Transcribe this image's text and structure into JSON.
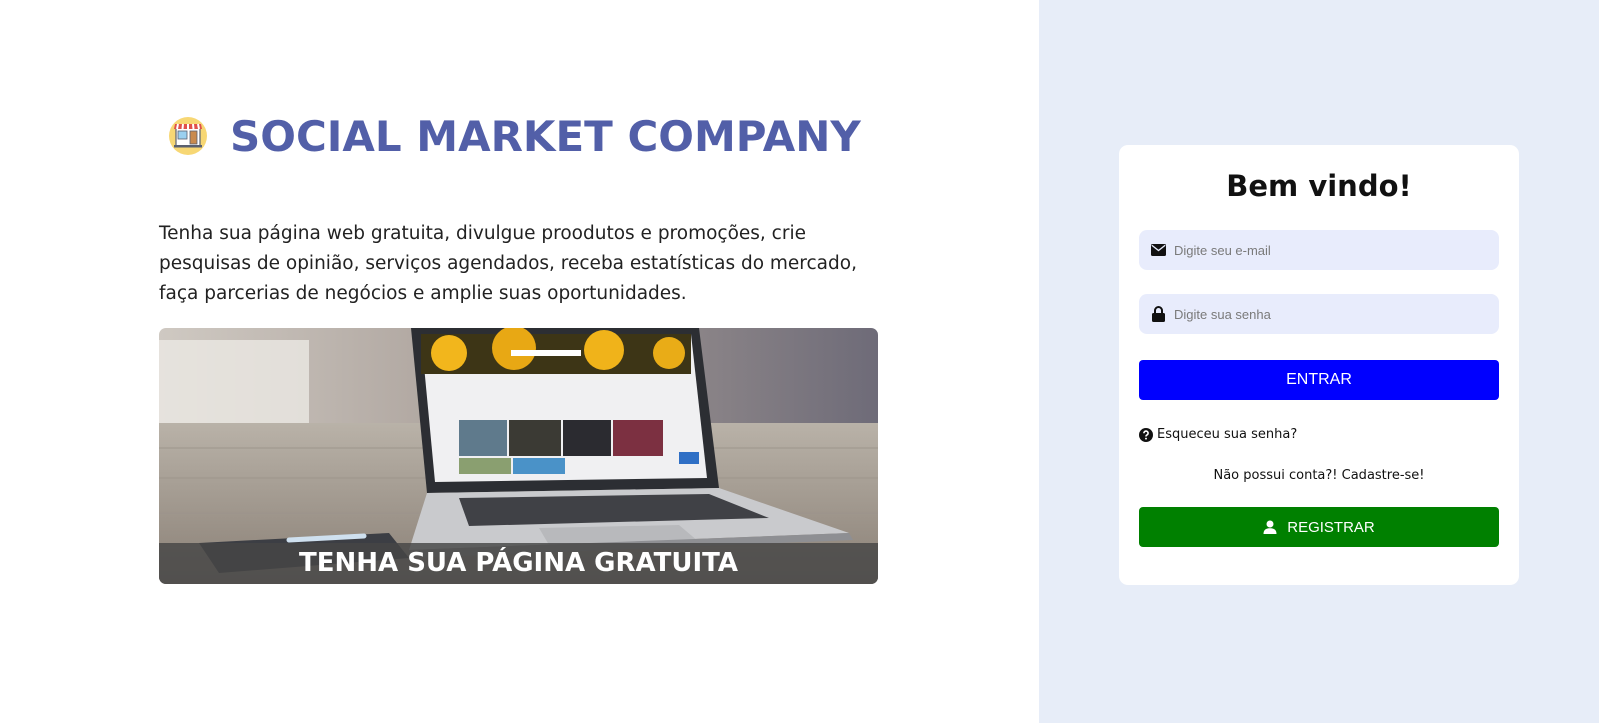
{
  "brand": {
    "title": "SOCIAL MARKET COMPANY",
    "logo_icon": "storefront-icon",
    "title_color": "#525fa8"
  },
  "intro": {
    "text": "Tenha sua página web gratuita, divulgue proodutos e promoções, crie pesquisas de opinião, serviços agendados, receba estatísticas do mercado, faça parcerias de negócios e amplie suas oportunidades."
  },
  "hero": {
    "caption": "TENHA SUA PÁGINA GRATUITA",
    "image_subject": "laptop-on-wooden-desk"
  },
  "login": {
    "title": "Bem vindo!",
    "email": {
      "placeholder": "Digite seu e-mail",
      "icon": "envelope-icon"
    },
    "password": {
      "placeholder": "Digite sua senha",
      "icon": "lock-icon"
    },
    "enter_button": "ENTRAR",
    "forgot_link": "Esqueceu sua senha?",
    "no_account_text": "Não possui conta?! Cadastre-se!",
    "register_button": "REGISTRAR",
    "colors": {
      "enter_bg": "#0000ff",
      "register_bg": "#008000",
      "panel_bg": "#e7edf8",
      "field_bg": "#e8ecfc"
    }
  }
}
